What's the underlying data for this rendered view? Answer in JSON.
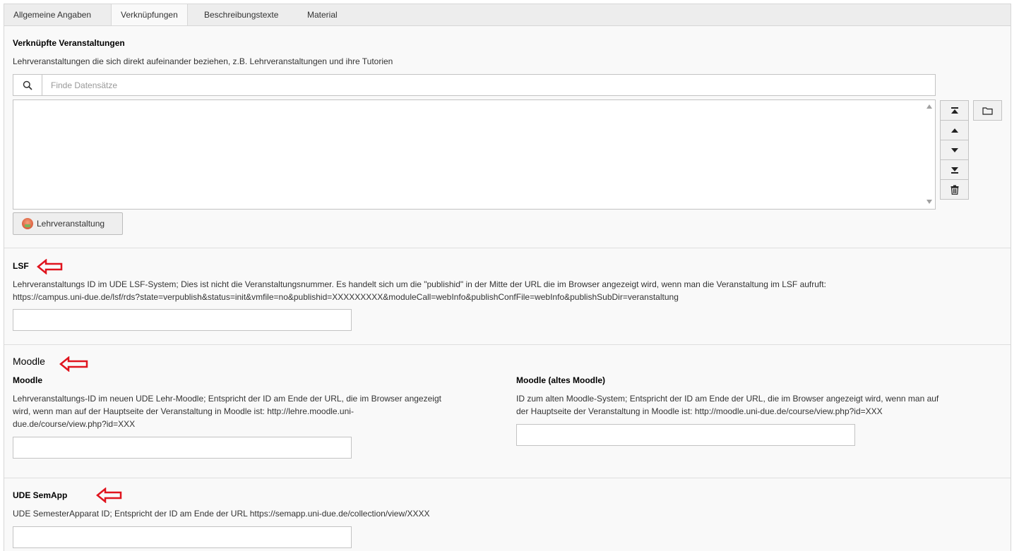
{
  "tabs": [
    {
      "label": "Allgemeine Angaben",
      "active": false
    },
    {
      "label": "Verknüpfungen",
      "active": true
    },
    {
      "label": "Beschreibungstexte",
      "active": false
    },
    {
      "label": "Material",
      "active": false
    }
  ],
  "linked": {
    "title": "Verknüpfte Veranstaltungen",
    "description": "Lehrveranstaltungen die sich direkt aufeinander beziehen, z.B. Lehrveranstaltungen und ihre Tutorien",
    "search_placeholder": "Finde Datensätze",
    "add_button_label": "Lehrveranstaltung"
  },
  "lsf": {
    "title": "LSF",
    "description_line1": "Lehrveranstaltungs ID im UDE LSF-System; Dies ist nicht die Veranstaltungsnummer. Es handelt sich um die \"publishid\" in der Mitte der URL die im Browser angezeigt wird, wenn man die Veranstaltung im LSF aufruft:",
    "description_line2": "https://campus.uni-due.de/lsf/rds?state=verpublish&status=init&vmfile=no&publishid=XXXXXXXXX&moduleCall=webInfo&publishConfFile=webInfo&publishSubDir=veranstaltung",
    "value": ""
  },
  "moodle": {
    "legend": "Moodle",
    "new": {
      "title": "Moodle",
      "description_line1": "Lehrveranstaltungs-ID im neuen UDE Lehr-Moodle; Entspricht der ID am Ende der URL, die im Browser angezeigt",
      "description_line2": "wird, wenn man auf der Hauptseite der Veranstaltung in Moodle ist: http://lehre.moodle.uni-",
      "description_line3": "due.de/course/view.php?id=XXX",
      "value": ""
    },
    "old": {
      "title": "Moodle (altes Moodle)",
      "description_line1": "ID zum alten Moodle-System; Entspricht der ID am Ende der URL, die im Browser angezeigt wird, wenn man auf",
      "description_line2": "der Hauptseite der Veranstaltung in Moodle ist: http://moodle.uni-due.de/course/view.php?id=XXX",
      "value": ""
    }
  },
  "semapp": {
    "title": "UDE SemApp",
    "description": "UDE SemesterApparat ID; Entspricht der ID am Ende der URL https://semapp.uni-due.de/collection/view/XXXX",
    "value": ""
  },
  "icons": {
    "search": "search-icon",
    "move_top": "move-to-top-icon",
    "move_up": "move-up-icon",
    "move_down": "move-down-icon",
    "move_bottom": "move-to-bottom-icon",
    "delete": "trash-icon",
    "browse": "folder-icon",
    "record": "course-record-icon",
    "annotation": "red-arrow-icon"
  },
  "colors": {
    "annotation_red": "#e0141e",
    "panel_bg": "#f9f9f9",
    "tabbar_bg": "#ededed"
  }
}
